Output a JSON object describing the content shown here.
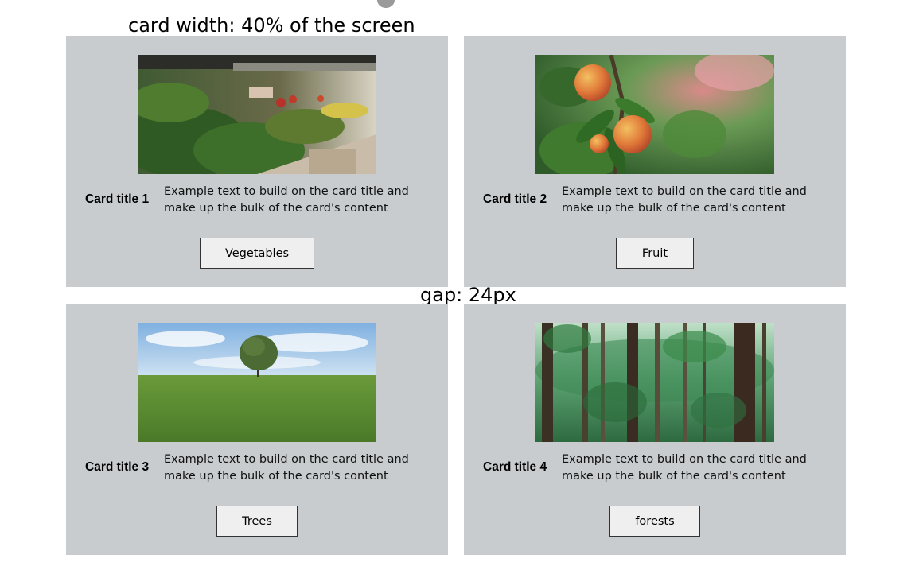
{
  "captions": {
    "card_width": "card width: 40% of the screen",
    "gap": "gap: 24px"
  },
  "cards": [
    {
      "title": "Card title 1",
      "text": "Example text to build on the card title and make up the bulk of the card's content",
      "button": "Vegetables",
      "image": "vegetables-market-image"
    },
    {
      "title": "Card title 2",
      "text": "Example text to build on the card title and make up the bulk of the card's content",
      "button": "Fruit",
      "image": "peaches-on-branch-image"
    },
    {
      "title": "Card title 3",
      "text": "Example text to build on the card title and make up the bulk of the card's content",
      "button": "Trees",
      "image": "lone-tree-field-image"
    },
    {
      "title": "Card title 4",
      "text": "Example text to build on the card title and make up the bulk of the card's content",
      "button": "forests",
      "image": "forest-trees-image"
    }
  ],
  "colors": {
    "card_background": "#c8cccf",
    "button_background": "#efefef"
  }
}
